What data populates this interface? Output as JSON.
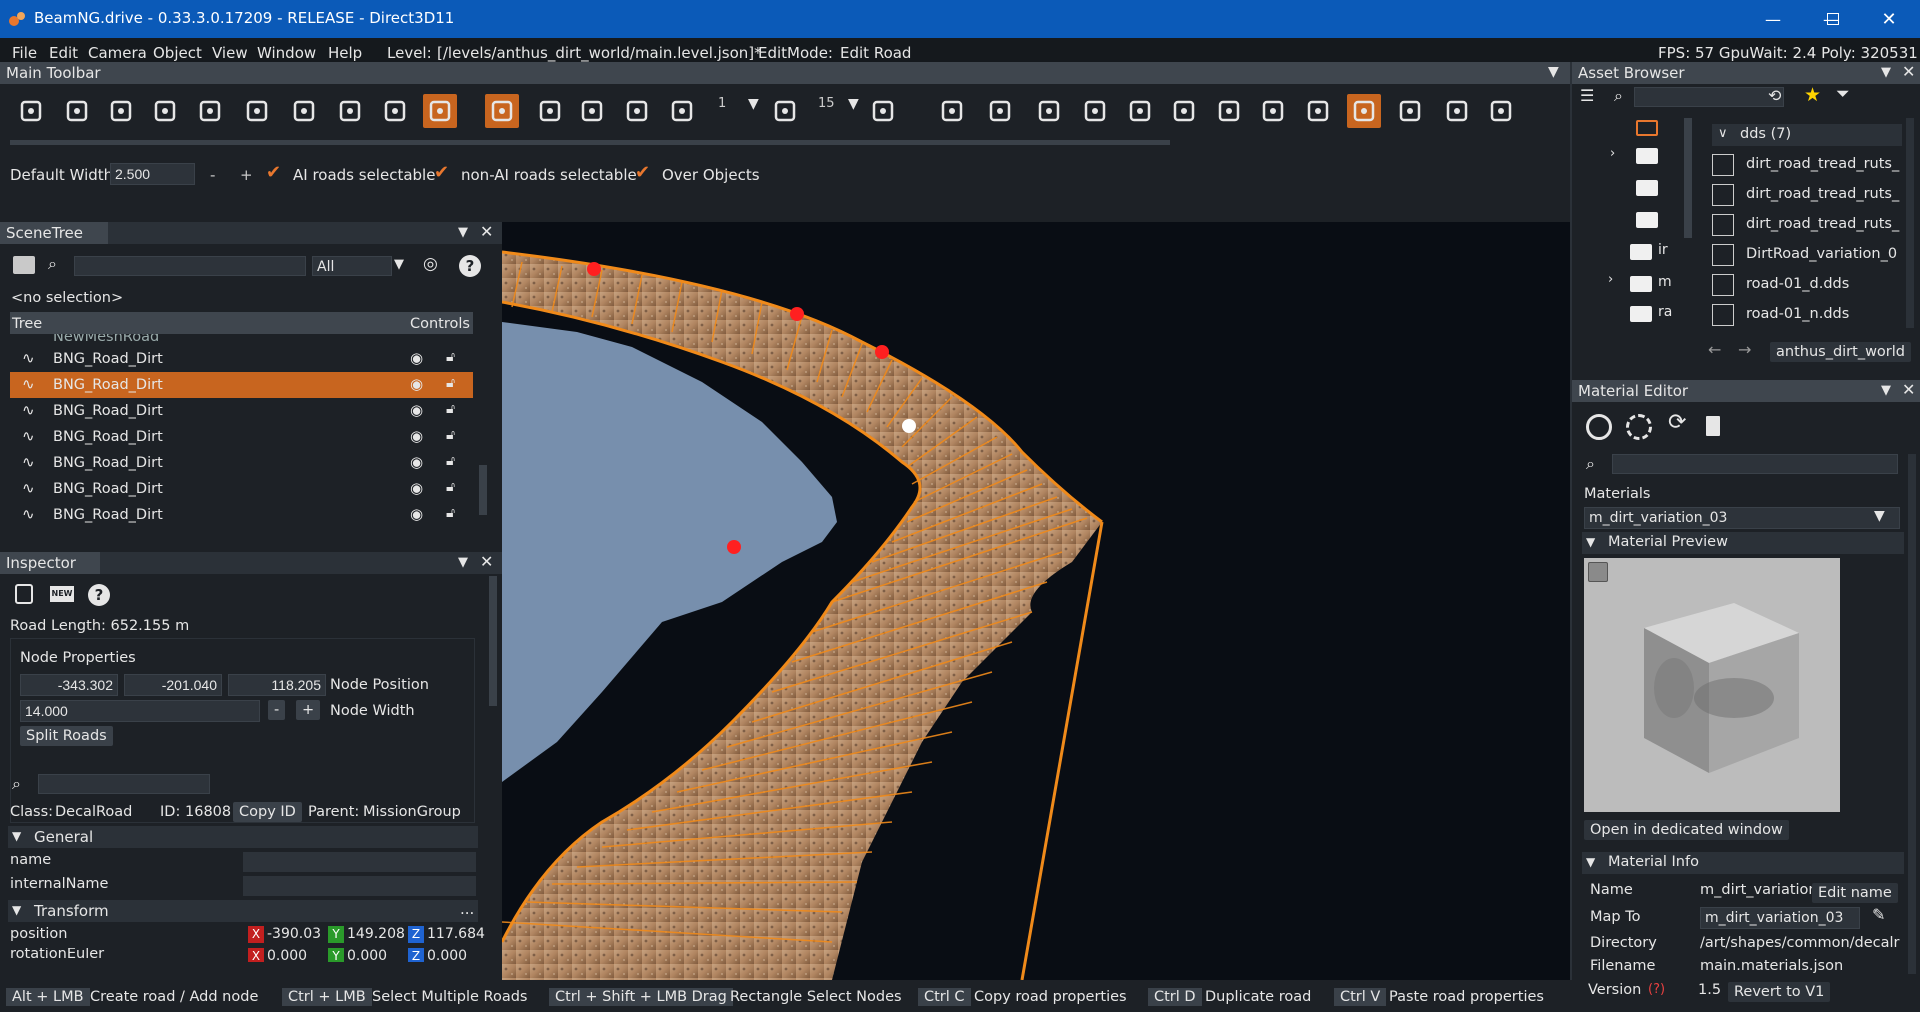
{
  "window": {
    "title": "BeamNG.drive - 0.33.3.0.17209 - RELEASE - Direct3D11"
  },
  "menu": {
    "items": [
      "File",
      "Edit",
      "Camera",
      "Object",
      "View",
      "Window",
      "Help"
    ],
    "level_label": "Level:",
    "level_path": "[/levels/anthus_dirt_world/main.level.json]*",
    "editmode_label": "EditMode:",
    "editmode_value": "Edit Road",
    "stats": "FPS: 57  GpuWait: 2.4  Poly: 320531"
  },
  "main_toolbar": {
    "title": "Main Toolbar",
    "snap_value": "1",
    "rotate_value": "15"
  },
  "road_options": {
    "default_width_label": "Default Width",
    "default_width_value": "2.500",
    "minus": "-",
    "plus": "+",
    "ai_roads_label": "AI roads selectable",
    "non_ai_roads_label": "non-AI roads selectable",
    "over_objects_label": "Over Objects"
  },
  "scene_tree": {
    "title": "SceneTree",
    "filter_value": "All",
    "no_selection": "<no selection>",
    "col_tree": "Tree",
    "col_controls": "Controls",
    "partial_top": "NewMeshRoad",
    "rows": [
      "BNG_Road_Dirt",
      "BNG_Road_Dirt",
      "BNG_Road_Dirt",
      "BNG_Road_Dirt",
      "BNG_Road_Dirt",
      "BNG_Road_Dirt",
      "BNG_Road_Dirt"
    ],
    "selected_index": 1
  },
  "inspector": {
    "title": "Inspector",
    "road_length": "Road Length: 652.155 m",
    "node_properties": "Node Properties",
    "pos_x": "-343.302",
    "pos_y": "-201.040",
    "pos_z": "118.205",
    "node_position_label": "Node Position",
    "node_width_value": "14.000",
    "node_width_label": "Node Width",
    "minus": "-",
    "plus": "+",
    "split_roads": "Split Roads",
    "class_label": "Class:",
    "class_value": "DecalRoad",
    "id_label": "ID:",
    "id_value": "16808",
    "copy_id": "Copy ID",
    "parent_label": "Parent:",
    "parent_value": "MissionGroup",
    "general": "General",
    "name_label": "name",
    "internal_name_label": "internalName",
    "transform": "Transform",
    "transform_more": "...",
    "position_label": "position",
    "position_x": "-390.03",
    "position_y": "149.208",
    "position_z": "117.684",
    "rotation_label": "rotationEuler",
    "rotation_x": "0.000",
    "rotation_y": "0.000",
    "rotation_z": "0.000",
    "axis_x": "X",
    "axis_y": "Y",
    "axis_z": "Z"
  },
  "asset_browser": {
    "title": "Asset Browser",
    "folder_header": "dds (7)",
    "items": [
      "dirt_road_tread_ruts_",
      "dirt_road_tread_ruts_",
      "dirt_road_tread_ruts_",
      "DirtRoad_variation_0",
      "road-01_d.dds",
      "road-01_n.dds"
    ],
    "tree_labels": [
      "",
      "",
      "",
      "",
      "ir",
      "m",
      "ra"
    ],
    "path": "anthus_dirt_world"
  },
  "material_editor": {
    "title": "Material Editor",
    "materials_label": "Materials",
    "material_value": "m_dirt_variation_03",
    "preview_header": "Material Preview",
    "open_window": "Open in dedicated window",
    "info_header": "Material Info",
    "name_label": "Name",
    "name_value": "m_dirt_variation_",
    "edit_name": "Edit name",
    "mapto_label": "Map To",
    "mapto_value": "m_dirt_variation_03",
    "directory_label": "Directory",
    "directory_value": "/art/shapes/common/decalr",
    "filename_label": "Filename",
    "filename_value": "main.materials.json",
    "version_label": "Version",
    "version_help": "(?)",
    "version_value": "1.5",
    "revert": "Revert to V1"
  },
  "statusbar": {
    "hints": [
      {
        "key": "Alt + LMB",
        "text": "Create road / Add node"
      },
      {
        "key": "Ctrl + LMB",
        "text": "Select Multiple Roads"
      },
      {
        "key": "Ctrl + Shift + LMB Drag",
        "text": "Rectangle Select Nodes"
      },
      {
        "key": "Ctrl C",
        "text": "Copy road properties"
      },
      {
        "key": "Ctrl D",
        "text": "Duplicate road"
      },
      {
        "key": "Ctrl V",
        "text": "Paste road properties"
      }
    ]
  },
  "colors": {
    "accent": "#e8772e",
    "titlebar": "#0b5ab8",
    "panel": "#1d2126",
    "selected": "#c8651f"
  }
}
